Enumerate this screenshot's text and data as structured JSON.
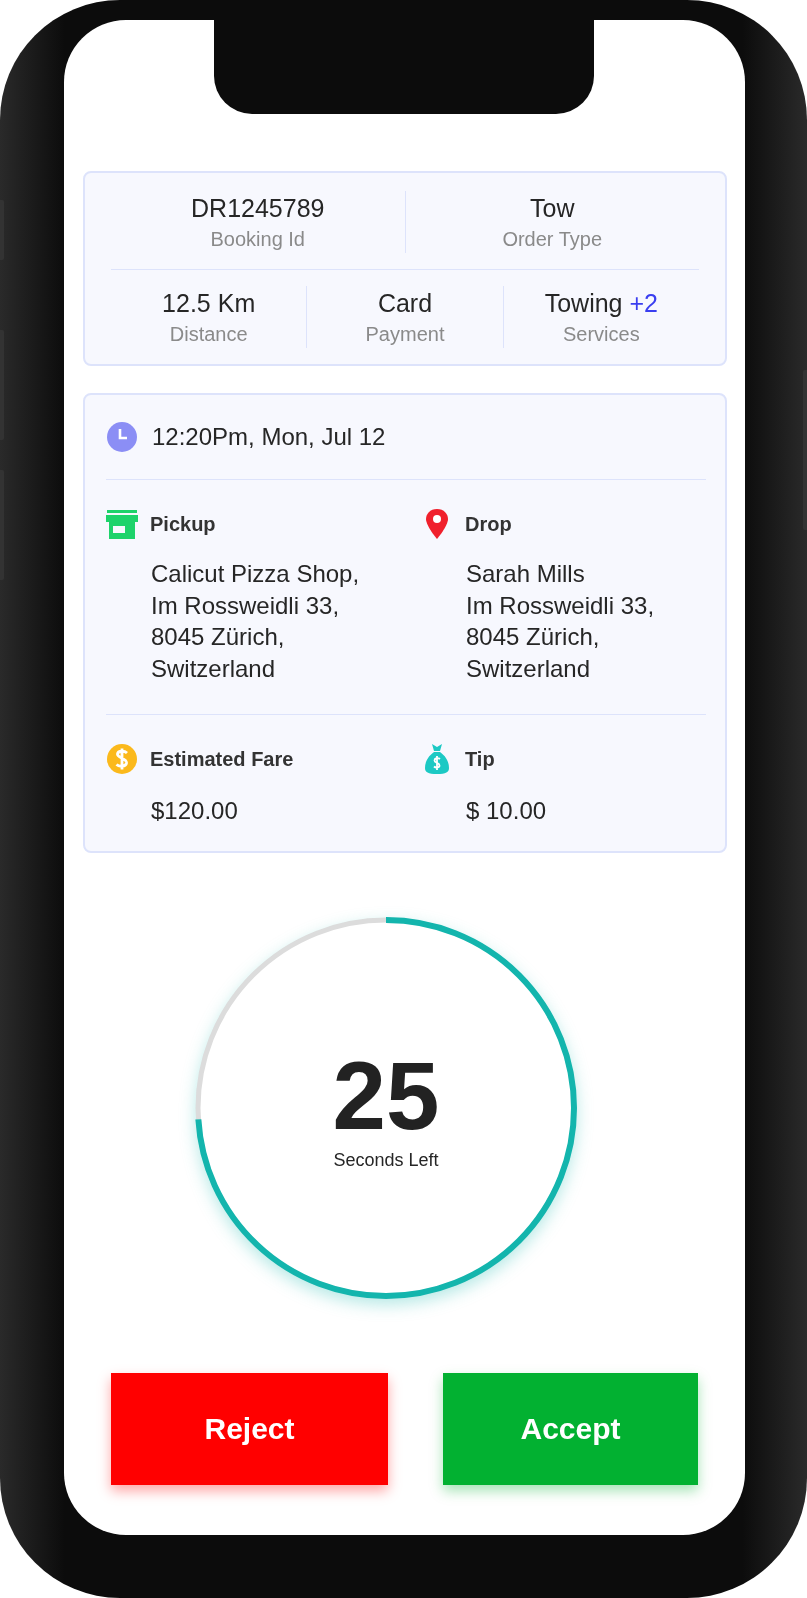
{
  "summary": {
    "rows": [
      [
        {
          "value": "DR1245789",
          "label": "Booking Id"
        },
        {
          "value": "Tow",
          "label": "Order Type"
        }
      ],
      [
        {
          "value": "12.5 Km",
          "label": "Distance"
        },
        {
          "value": "Card",
          "label": "Payment"
        },
        {
          "value": "Towing",
          "extra": "+2",
          "label": "Services"
        }
      ]
    ]
  },
  "details": {
    "time": "12:20Pm, Mon, Jul 12",
    "places": [
      {
        "kind": "pickup",
        "label": "Pickup",
        "address": "Calicut Pizza Shop,\nIm Rossweidli 33,\n8045 Zürich,\nSwitzerland"
      },
      {
        "kind": "drop",
        "label": "Drop",
        "address": "Sarah Mills\nIm Rossweidli 33,\n8045 Zürich,\nSwitzerland"
      }
    ],
    "amounts": [
      {
        "kind": "fare",
        "label": "Estimated Fare",
        "value": "$120.00"
      },
      {
        "kind": "tip",
        "label": "Tip",
        "value": "$ 10.00"
      }
    ]
  },
  "timer": {
    "value": "25",
    "caption": "Seconds Left",
    "level": 0.74
  },
  "buttons": [
    {
      "kind": "reject",
      "label": "Reject"
    },
    {
      "kind": "accept",
      "label": "Accept"
    }
  ]
}
